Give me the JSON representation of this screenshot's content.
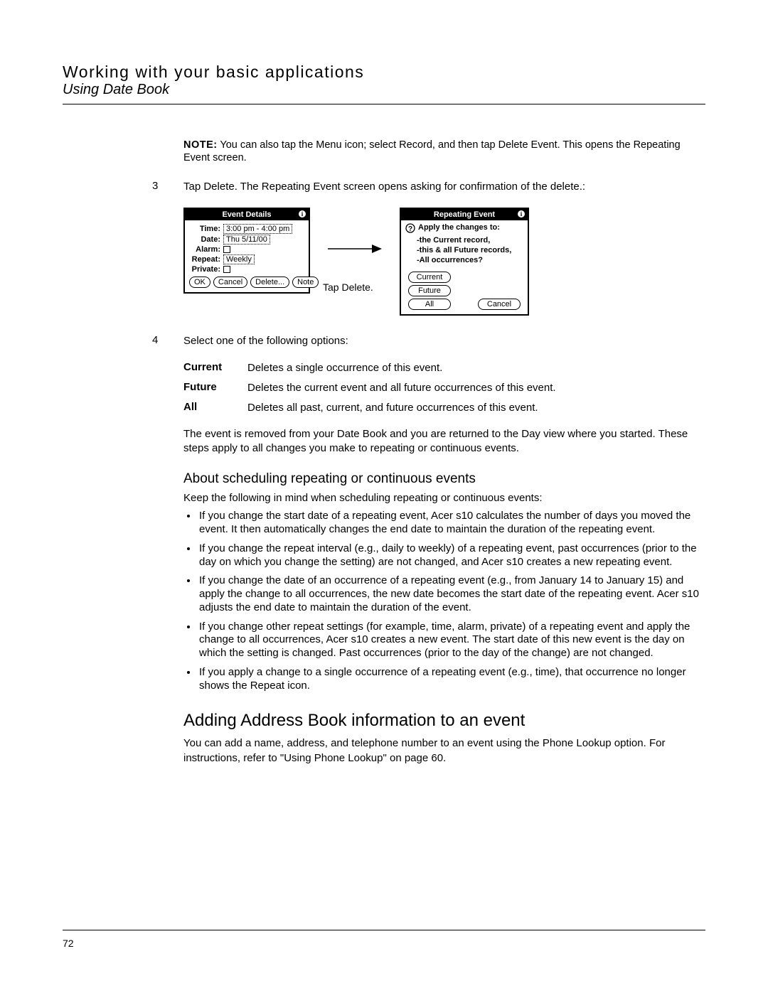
{
  "header": {
    "chapter": "Working with your basic applications",
    "section": "Using Date Book"
  },
  "note": {
    "label": "NOTE:",
    "text": "You can also tap the Menu icon; select Record, and then tap Delete Event. This opens the Repeating Event screen."
  },
  "step3": {
    "num": "3",
    "text": "Tap Delete. The Repeating Event screen opens asking for confirmation of the delete.:"
  },
  "figure": {
    "left": {
      "title": "Event Details",
      "time_lbl": "Time:",
      "time_val": "3:00 pm - 4:00 pm",
      "date_lbl": "Date:",
      "date_val": "Thu 5/11/00",
      "alarm_lbl": "Alarm:",
      "repeat_lbl": "Repeat:",
      "repeat_val": "Weekly",
      "private_lbl": "Private:",
      "btn_ok": "OK",
      "btn_cancel": "Cancel",
      "btn_delete": "Delete...",
      "btn_note": "Note"
    },
    "tap_label": "Tap Delete.",
    "right": {
      "title": "Repeating Event",
      "question": "Apply the changes to:",
      "opt1": "-the Current record,",
      "opt2": "-this & all Future records,",
      "opt3": "-All occurrences?",
      "btn_current": "Current",
      "btn_future": "Future",
      "btn_all": "All",
      "btn_cancel": "Cancel"
    }
  },
  "step4": {
    "num": "4",
    "text": "Select one of the following options:"
  },
  "options": [
    {
      "term": "Current",
      "def": "Deletes a single occurrence of this event."
    },
    {
      "term": "Future",
      "def": "Deletes the current event and all future occurrences of this event."
    },
    {
      "term": "All",
      "def": "Deletes all past, current, and future occurrences of this event."
    }
  ],
  "removed_para": "The event is removed from your Date Book and you are returned to the Day view where you started. These steps apply to all changes you make to repeating or continuous events.",
  "subheading": "About scheduling repeating or continuous events",
  "keep_para": "Keep the following in mind when scheduling repeating or continuous events:",
  "bullets": [
    "If you change the start date of a repeating event, Acer s10 calculates the number of days you moved the event. It then automatically changes the end date to maintain the duration of the repeating event.",
    "If you change the repeat interval (e.g., daily to weekly) of a repeating event, past occurrences (prior to the day on which you change the setting) are not changed, and Acer s10 creates a new repeating event.",
    "If you change the date of an occurrence of a repeating event (e.g., from January 14 to January 15) and apply the change to all occurrences, the new date becomes the start date of the repeating event. Acer s10 adjusts the end date to maintain the duration of the event.",
    "If you change other repeat settings (for example, time, alarm, private) of a repeating event and apply the change to all occurrences, Acer s10 creates a new event. The start date of this new event is the day on which the setting is changed. Past occurrences (prior to the day of the change) are not changed.",
    "If you apply a change to a single occurrence of a repeating event (e.g., time), that occurrence no longer shows the Repeat icon."
  ],
  "heading2": "Adding Address Book information to an event",
  "add_para": "You can add a name, address, and telephone number to an event using the Phone Lookup option. For instructions, refer to \"Using Phone Lookup\" on page 60.",
  "page_number": "72"
}
